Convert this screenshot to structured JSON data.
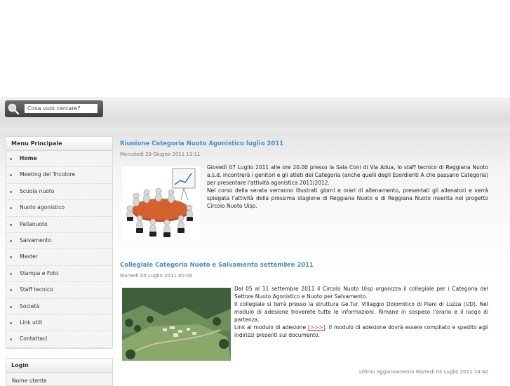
{
  "search": {
    "placeholder": "Cosa vuoi cercare?"
  },
  "menu": {
    "title": "Menu Principale",
    "items": [
      {
        "label": "Home",
        "active": true
      },
      {
        "label": "Meeting del Tricolore"
      },
      {
        "label": "Scuola nuoto"
      },
      {
        "label": "Nuoto agonistico"
      },
      {
        "label": "Pallanuoto"
      },
      {
        "label": "Salvamento"
      },
      {
        "label": "Master"
      },
      {
        "label": "Stampa e Foto"
      },
      {
        "label": "Staff tecnico"
      },
      {
        "label": "Società"
      },
      {
        "label": "Link utili"
      },
      {
        "label": "Contattaci"
      }
    ]
  },
  "login": {
    "title": "Login",
    "username_label": "Nome utente"
  },
  "articles": [
    {
      "title": "Riunione Categoria Nuoto Agonistico luglio 2011",
      "date": "Mercoledì 29 Giugno 2011 13:11",
      "image": "meeting-illustration",
      "paragraphs": [
        "Giovedì 07 Luglio 2011 alle ore 20.00 presso la Sala Coni di Via Adua, lo staff tecnico di Reggiana Nuoto a.s.d. incontrerà i genitori e gli atleti dei Categoria (anche quelli degli Esordienti A che passano Categoria) per presentare l'attività agonistica 2011/2012.",
        "Nel corso della serata verranno illustrati giorni e orari di allenamento, presentati gli allenatori e verrà spiegata l'attività della prossima stagione di Reggiana Nuoto e di Reggiana Nuoto inserita nel progetto Circolo Nuoto Uisp."
      ]
    },
    {
      "title": "Collegiale Categoria Nuoto e Salvamento settembre 2011",
      "date": "Martedì 05 Luglio 2011 00:00",
      "image": "mountain-village-photo",
      "paragraphs": [
        "Dal 05 al 11 settembre 2011 il Circolo Nuoto Uisp organizza il collegiale per i Categoria del Settore Nuoto Agonistico e Nuoto per Salvamento.",
        "Il collegiale si terrà presso la struttura Ge.Tur. Villaggio Dolomitico di Piani di Luzza (UD). Nel modulo di adesione troverete tutte le informazioni. Rimane in sospeso l'orario e il luogo di partenza."
      ],
      "link_para_before": "Link al modulo di adesione ",
      "link_text": "[>>>]",
      "link_para_after": ". Il modulo di adesione dovrà essere compilato e spedito agli indirizzi presenti sul documento."
    }
  ],
  "footer": {
    "last_update": "Ultimo aggiornamento Martedì 05 Luglio 2011 14:42"
  },
  "colors": {
    "accent": "#4a8ec7",
    "bullet": "#3a8bc9"
  }
}
